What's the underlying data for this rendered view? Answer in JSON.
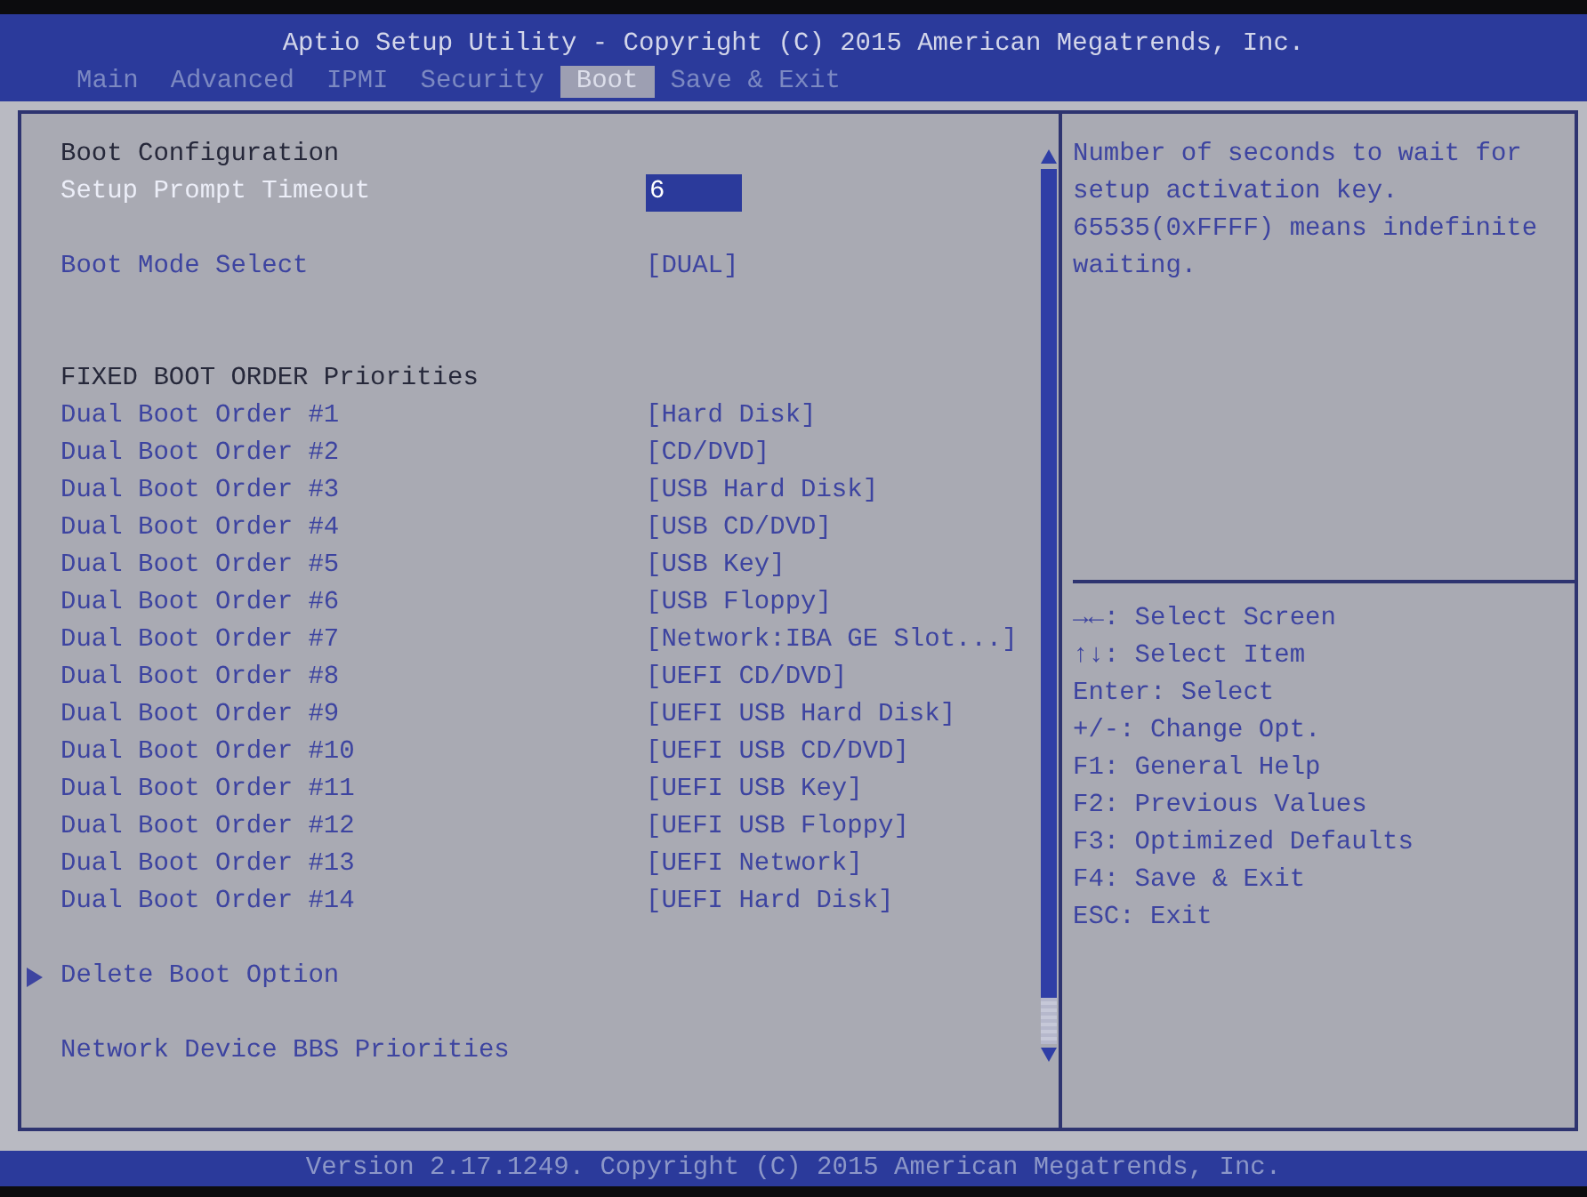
{
  "header": {
    "title": "Aptio Setup Utility - Copyright (C) 2015 American Megatrends, Inc.",
    "tabs": [
      {
        "label": "Main",
        "selected": false
      },
      {
        "label": "Advanced",
        "selected": false
      },
      {
        "label": "IPMI",
        "selected": false
      },
      {
        "label": "Security",
        "selected": false
      },
      {
        "label": "Boot",
        "selected": true
      },
      {
        "label": "Save & Exit",
        "selected": false
      }
    ]
  },
  "settings": {
    "rows": [
      {
        "kind": "heading",
        "label": "Boot Configuration"
      },
      {
        "kind": "option",
        "label": "Setup Prompt Timeout",
        "value": "6",
        "selected": true
      },
      {
        "kind": "blank"
      },
      {
        "kind": "option",
        "label": "Boot Mode Select",
        "value": "[DUAL]",
        "selected": false
      },
      {
        "kind": "blank"
      },
      {
        "kind": "blank"
      },
      {
        "kind": "heading",
        "label": "FIXED BOOT ORDER Priorities"
      },
      {
        "kind": "option",
        "label": "Dual Boot Order #1",
        "value": "[Hard Disk]",
        "selected": false
      },
      {
        "kind": "option",
        "label": "Dual Boot Order #2",
        "value": "[CD/DVD]",
        "selected": false
      },
      {
        "kind": "option",
        "label": "Dual Boot Order #3",
        "value": "[USB Hard Disk]",
        "selected": false
      },
      {
        "kind": "option",
        "label": "Dual Boot Order #4",
        "value": "[USB CD/DVD]",
        "selected": false
      },
      {
        "kind": "option",
        "label": "Dual Boot Order #5",
        "value": "[USB Key]",
        "selected": false
      },
      {
        "kind": "option",
        "label": "Dual Boot Order #6",
        "value": "[USB Floppy]",
        "selected": false
      },
      {
        "kind": "option",
        "label": "Dual Boot Order #7",
        "value": "[Network:IBA GE Slot...]",
        "selected": false
      },
      {
        "kind": "option",
        "label": "Dual Boot Order #8",
        "value": "[UEFI CD/DVD]",
        "selected": false
      },
      {
        "kind": "option",
        "label": "Dual Boot Order #9",
        "value": "[UEFI USB Hard Disk]",
        "selected": false
      },
      {
        "kind": "option",
        "label": "Dual Boot Order #10",
        "value": "[UEFI USB CD/DVD]",
        "selected": false
      },
      {
        "kind": "option",
        "label": "Dual Boot Order #11",
        "value": "[UEFI USB Key]",
        "selected": false
      },
      {
        "kind": "option",
        "label": "Dual Boot Order #12",
        "value": "[UEFI USB Floppy]",
        "selected": false
      },
      {
        "kind": "option",
        "label": "Dual Boot Order #13",
        "value": "[UEFI Network]",
        "selected": false
      },
      {
        "kind": "option",
        "label": "Dual Boot Order #14",
        "value": "[UEFI Hard Disk]",
        "selected": false
      },
      {
        "kind": "blank"
      },
      {
        "kind": "submenu",
        "label": "Delete Boot Option",
        "selected": false
      },
      {
        "kind": "blank"
      },
      {
        "kind": "action",
        "label": "Network Device BBS Priorities",
        "selected": false
      }
    ]
  },
  "help": {
    "description": [
      "Number of seconds to wait for setup activation key.",
      "65535(0xFFFF) means indefinite waiting."
    ],
    "keys": [
      "→←: Select Screen",
      "↑↓: Select Item",
      "Enter: Select",
      "+/-: Change Opt.",
      "F1: General Help",
      "F2: Previous Values",
      "F3: Optimized Defaults",
      "F4: Save & Exit",
      "ESC: Exit"
    ]
  },
  "footer": {
    "text": "Version 2.17.1249. Copyright (C) 2015 American Megatrends, Inc."
  }
}
